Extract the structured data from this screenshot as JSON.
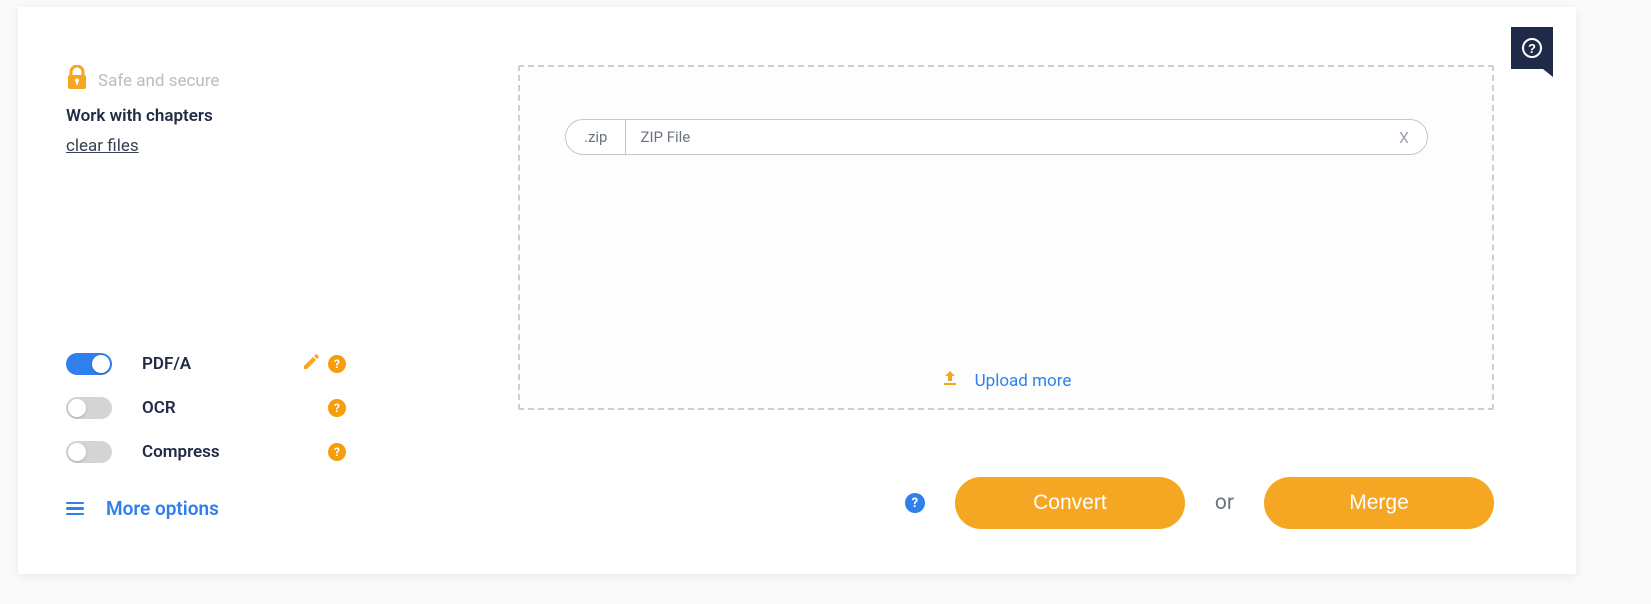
{
  "sidebar": {
    "secure_text": "Safe and secure",
    "chapters": "Work with chapters",
    "clear_files": "clear files"
  },
  "toggles": {
    "pdfa": {
      "label": "PDF/A",
      "on": true
    },
    "ocr": {
      "label": "OCR",
      "on": false
    },
    "compress": {
      "label": "Compress",
      "on": false
    }
  },
  "more_options": "More options",
  "file": {
    "ext": ".zip",
    "name": "ZIP File",
    "remove": "X"
  },
  "upload_more": "Upload more",
  "actions": {
    "convert": "Convert",
    "or": "or",
    "merge": "Merge"
  },
  "help_glyph": "?"
}
